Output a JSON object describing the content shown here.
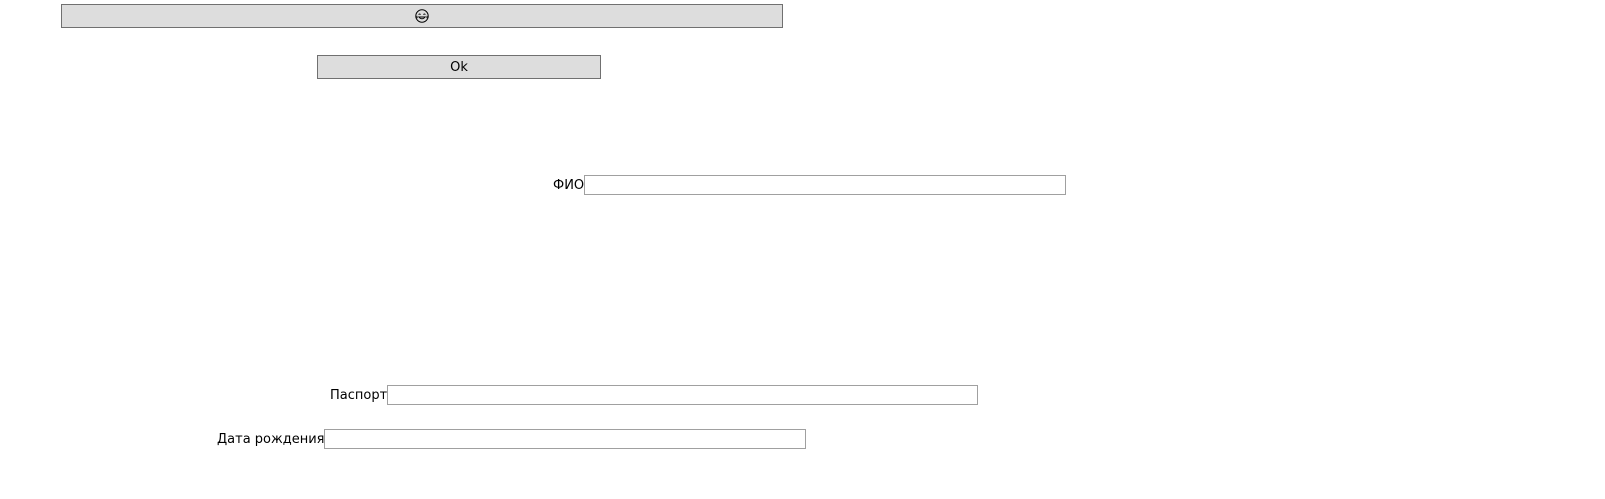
{
  "buttons": {
    "emoji": {
      "icon": "face-with-tears-of-joy-icon",
      "label": "😂"
    },
    "ok": {
      "label": "Ok"
    }
  },
  "form": {
    "fio": {
      "label": "ФИО",
      "value": ""
    },
    "passport": {
      "label": "Паспорт",
      "value": ""
    },
    "birth_date": {
      "label": "Дата рождения",
      "value": ""
    }
  },
  "colors": {
    "button_bg": "#dddddd",
    "button_border": "#707070",
    "field_border": "#a0a0a0",
    "background": "#ffffff"
  }
}
